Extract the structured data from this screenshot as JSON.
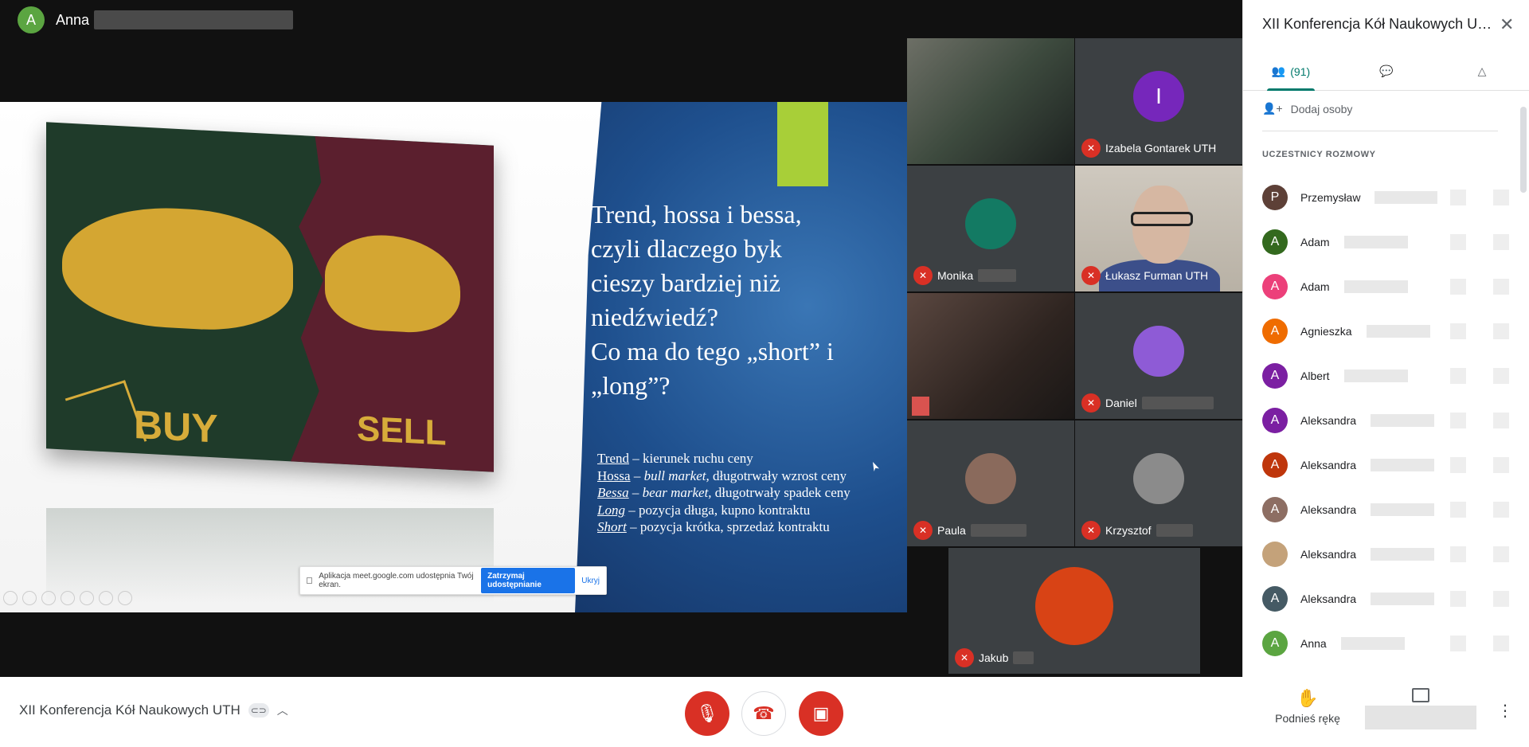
{
  "presenter": {
    "initial": "A",
    "name": "Anna"
  },
  "slide": {
    "left_text": {
      "buy": "BUY",
      "sell": "SELL"
    },
    "title_lines": [
      "Trend, hossa i bessa,",
      "czyli dlaczego byk",
      "cieszy bardziej niż",
      "niedźwiedź?",
      "Co ma do tego „short” i",
      "„long”?"
    ],
    "body": [
      {
        "term": "Trend",
        "rest": " – kierunek ruchu ceny"
      },
      {
        "term": "Hossa",
        "italic": " – bull market,",
        "rest": " długotrwały wzrost ceny"
      },
      {
        "term": "Bessa",
        "italic": " – bear market,",
        "rest": " długotrwały spadek ceny"
      },
      {
        "term": "Long",
        "rest": " – pozycja długa, kupno kontraktu"
      },
      {
        "term": "Short",
        "rest": " – pozycja krótka, sprzedaż kontraktu"
      }
    ],
    "share_banner": {
      "message": "Aplikacja meet.google.com udostępnia Twój ekran.",
      "stop_label": "Zatrzymaj udostępnianie",
      "hide_label": "Ukryj"
    }
  },
  "tiles": [
    {
      "name": "",
      "kind": "blur",
      "muted": false
    },
    {
      "name": "Izabela Gontarek UTH",
      "kind": "avatar",
      "initial": "I",
      "color": "#7627bb",
      "muted": true
    },
    {
      "name": "Monika",
      "kind": "blurcircle",
      "color": "#137a63",
      "muted": true
    },
    {
      "name": "Łukasz Furman UTH",
      "kind": "photo",
      "muted": true
    },
    {
      "name": "",
      "kind": "blur2",
      "muted": false
    },
    {
      "name": "Daniel",
      "kind": "blurcircle",
      "color": "#8e5bd6",
      "muted": true
    },
    {
      "name": "Paula",
      "kind": "blurcircle",
      "color": "#8a6a5c",
      "muted": true
    },
    {
      "name": "Krzysztof",
      "kind": "blurcircle",
      "color": "#8b8b8b",
      "muted": true
    },
    {
      "name": "Jakub",
      "kind": "blurcircle",
      "color": "#d84315",
      "muted": true
    }
  ],
  "bottombar": {
    "meeting_title": "XII Konferencja Kół Naukowych UTH",
    "raise_hand_label": "Podnieś rękę"
  },
  "panel": {
    "title": "XII Konferencja Kół Naukowych UTH",
    "participants_count": "(91)",
    "add_people_label": "Dodaj osoby",
    "section_label": "UCZESTNICY ROZMOWY",
    "participants": [
      {
        "initial": "P",
        "name": "Przemysław",
        "color": "#5d4037"
      },
      {
        "initial": "A",
        "name": "Adam",
        "color": "#33691e"
      },
      {
        "initial": "A",
        "name": "Adam",
        "color": "#ec407a"
      },
      {
        "initial": "A",
        "name": "Agnieszka",
        "color": "#ef6c00"
      },
      {
        "initial": "A",
        "name": "Albert",
        "color": "#7b1fa2"
      },
      {
        "initial": "A",
        "name": "Aleksandra",
        "color": "#7b1fa2"
      },
      {
        "initial": "A",
        "name": "Aleksandra",
        "color": "#bf360c"
      },
      {
        "initial": "A",
        "name": "Aleksandra",
        "color": "#8d6e63"
      },
      {
        "initial": "",
        "name": "Aleksandra",
        "color": "#c4a27a"
      },
      {
        "initial": "A",
        "name": "Aleksandra",
        "color": "#455a64"
      },
      {
        "initial": "A",
        "name": "Anna",
        "color": "#5ba541"
      }
    ]
  }
}
